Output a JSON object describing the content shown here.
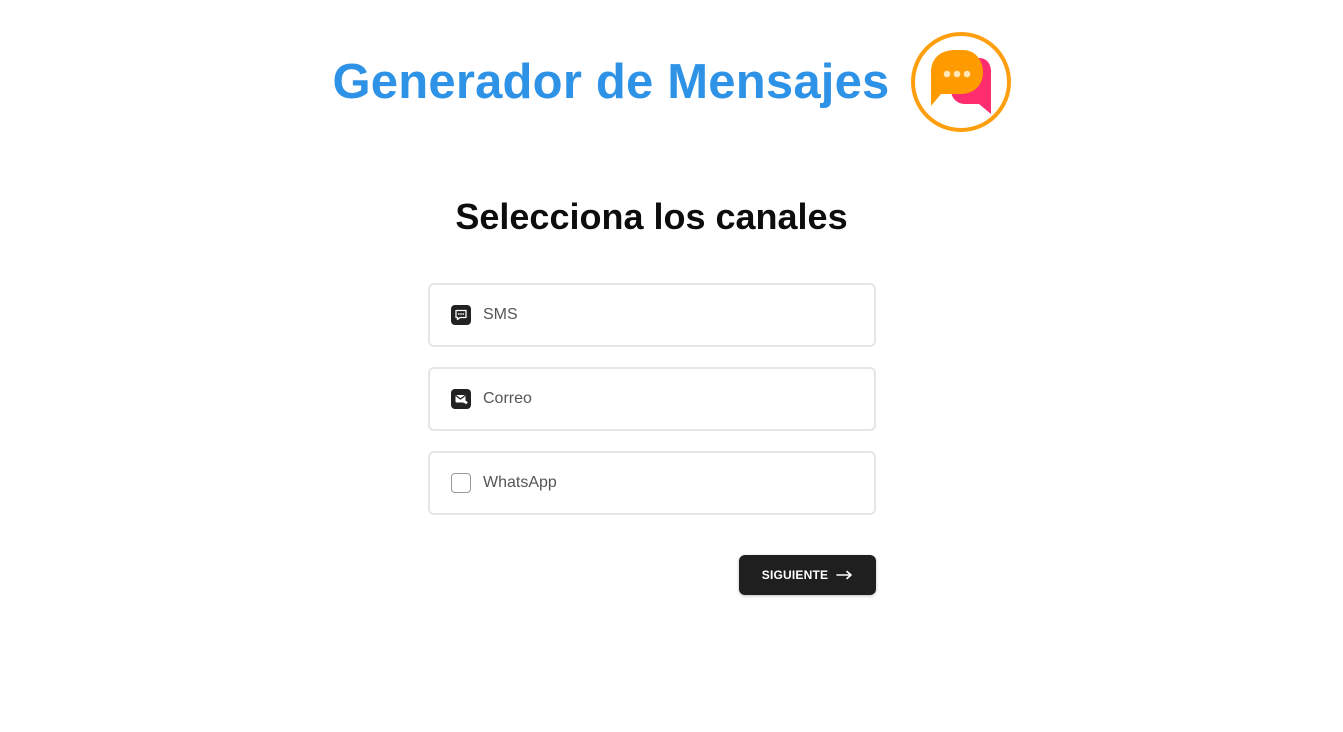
{
  "header": {
    "title": "Generador de Mensajes",
    "logo_icon": "chat-bubbles-icon"
  },
  "main": {
    "heading": "Selecciona los canales",
    "channels": [
      {
        "label": "SMS",
        "icon": "sms-icon",
        "checked": true
      },
      {
        "label": "Correo",
        "icon": "mail-icon",
        "checked": true
      },
      {
        "label": "WhatsApp",
        "icon": "checkbox-empty-icon",
        "checked": false
      }
    ],
    "next_button": {
      "label": "SIGUIENTE",
      "icon": "arrow-right-icon"
    }
  },
  "colors": {
    "title": "#2e93e6",
    "logo_ring": "#ff9f0f",
    "logo_front": "#ff9a00",
    "logo_back": "#ff2d6e",
    "button_bg": "#1f1f1f"
  }
}
